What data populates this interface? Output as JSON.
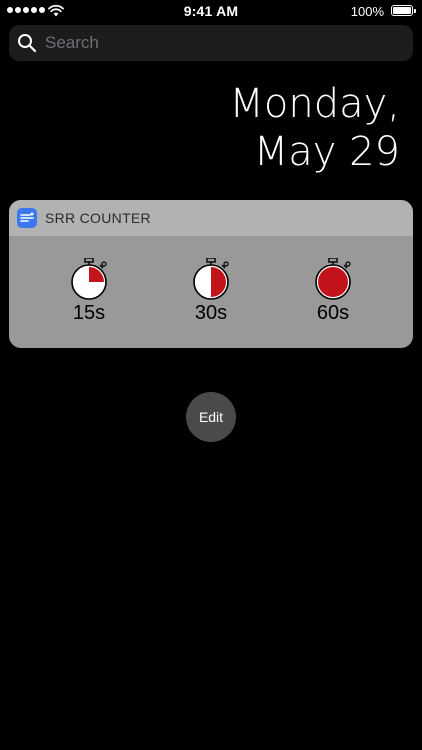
{
  "status_bar": {
    "time": "9:41 AM",
    "battery_percent": "100%",
    "signal_bars": 5,
    "wifi_icon": "wifi-icon",
    "battery_icon": "battery-icon"
  },
  "search": {
    "placeholder": "Search",
    "value": "",
    "icon": "search-icon"
  },
  "date": {
    "weekday": "Monday,",
    "day": "May 29"
  },
  "widget": {
    "app_name": "SRR COUNTER",
    "app_icon": "srr-counter-app-icon",
    "header_color": "#b2b2b2",
    "body_color": "#999999",
    "fill_color": "#c3141b",
    "timers": [
      {
        "label": "15s",
        "fill_fraction": 0.25,
        "icon": "stopwatch-icon"
      },
      {
        "label": "30s",
        "fill_fraction": 0.5,
        "icon": "stopwatch-icon"
      },
      {
        "label": "60s",
        "fill_fraction": 1.0,
        "icon": "stopwatch-icon"
      }
    ]
  },
  "edit_button": {
    "label": "Edit"
  }
}
